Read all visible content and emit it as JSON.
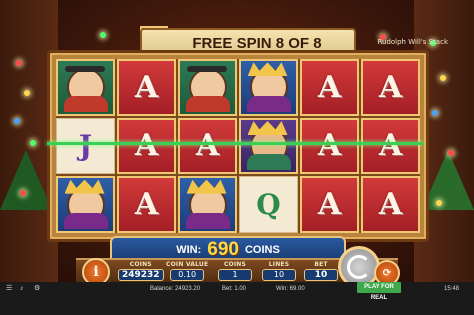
{
  "header": {
    "title": "FREE SPIN 8 OF 8",
    "badge_letter": "A"
  },
  "brand_text": "Rudolph Will's Stack",
  "reels": [
    [
      "elf-character",
      "A",
      "elf-character",
      "king-character",
      "A",
      "A"
    ],
    [
      "J",
      "A",
      "A",
      "elf-band-character",
      "A",
      "A"
    ],
    [
      "king-character",
      "A",
      "king-character",
      "Q",
      "A",
      "A"
    ]
  ],
  "win": {
    "label": "WIN:",
    "value": "690",
    "unit": "COINS"
  },
  "controls": {
    "coins": {
      "label": "COINS",
      "value": "249232"
    },
    "coin_value": {
      "label": "COIN VALUE",
      "value": "0.10"
    },
    "coin_level": {
      "label": "COINS",
      "value": "1"
    },
    "lines": {
      "label": "LINES",
      "value": "10"
    },
    "bet": {
      "label": "BET",
      "value": "10"
    }
  },
  "bottom": {
    "balance": "Balance: 24923.20",
    "bet": "Bet: 1.00",
    "win": "Win: 69.00",
    "play_for_real": "PLAY FOR REAL",
    "time": "15:48"
  },
  "colors": {
    "accent_red": "#c63030",
    "panel_blue": "#1d3c78",
    "gold": "#f0c874",
    "payline": "#3ccf55"
  }
}
